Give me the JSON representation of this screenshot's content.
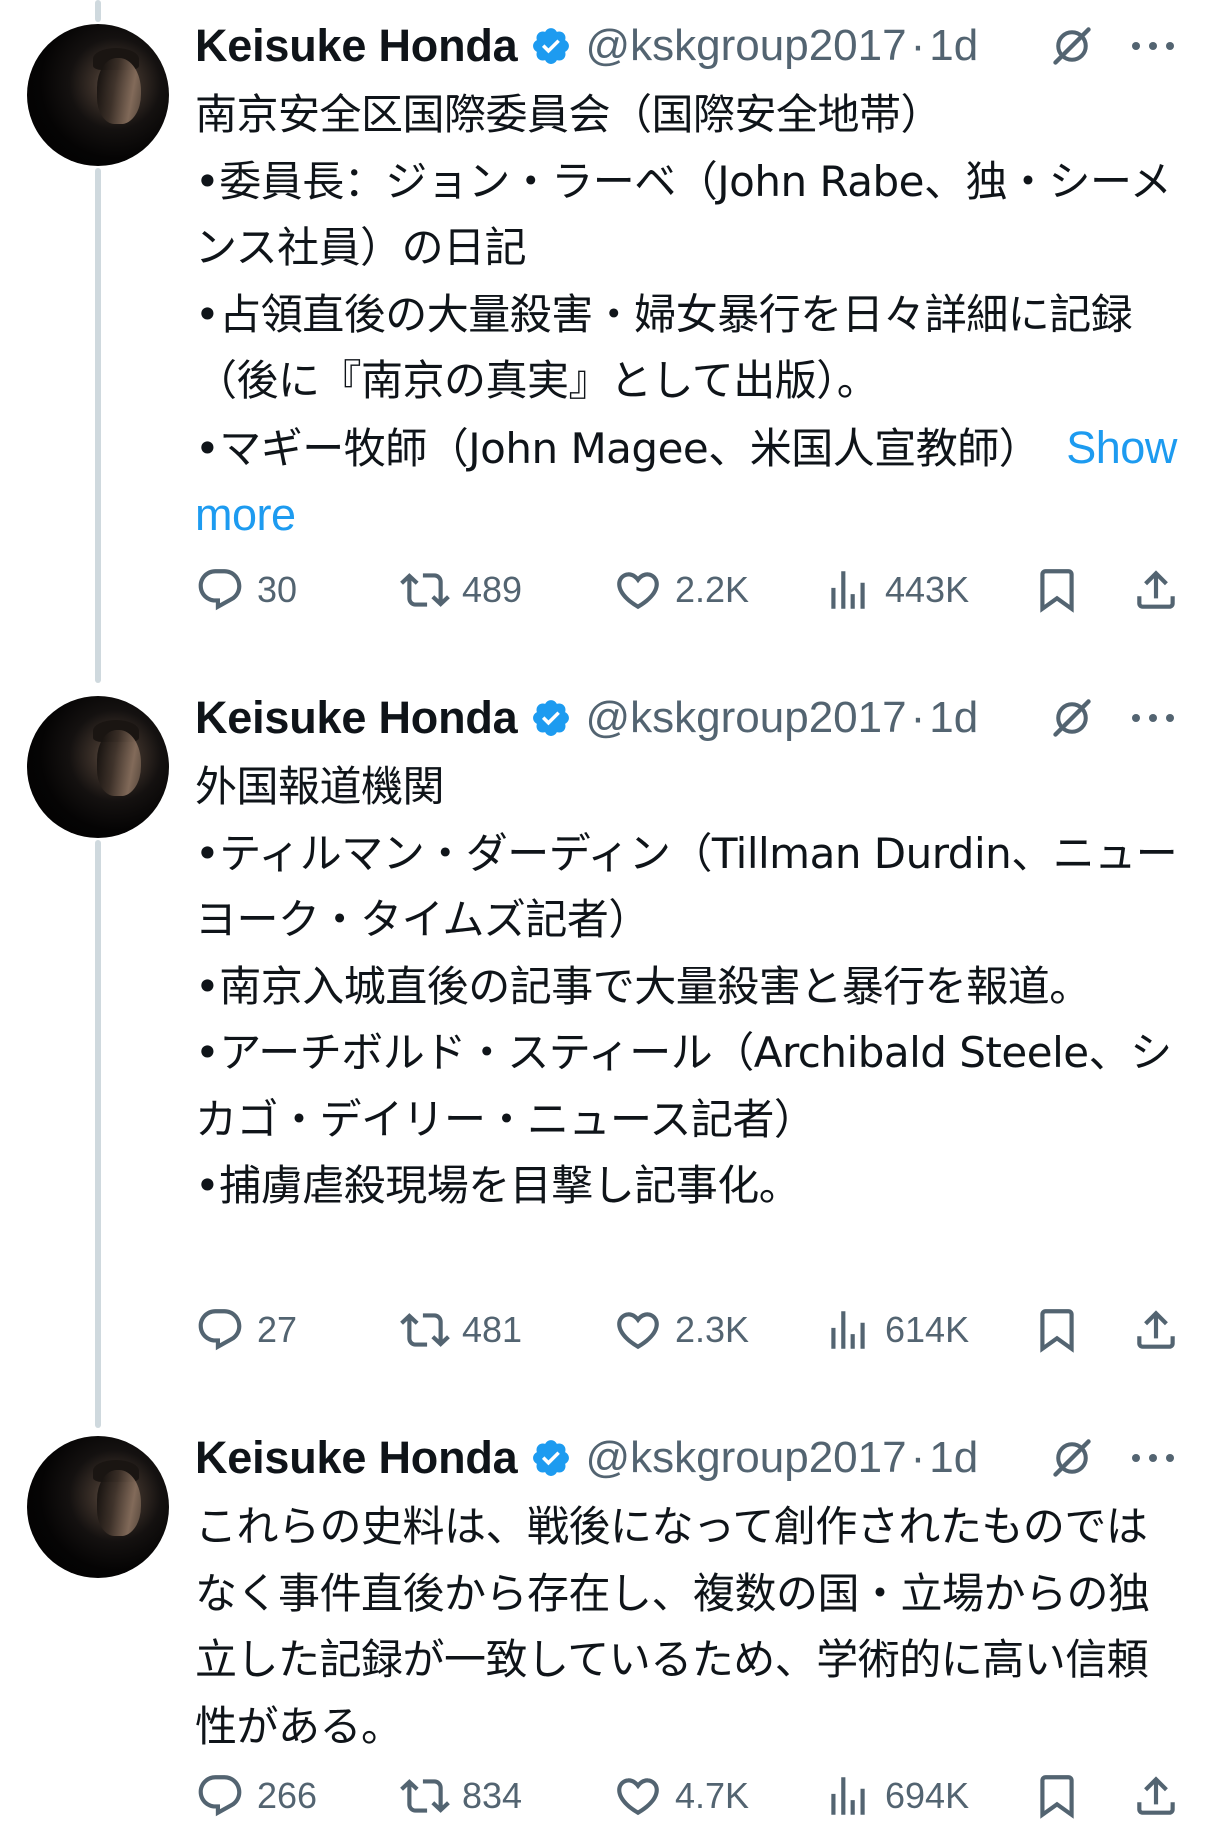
{
  "tweets": [
    {
      "name": "Keisuke Honda",
      "handle": "@kskgroup2017",
      "separator": "·",
      "time": "1d",
      "text": "南京安全区国際委員会（国際安全地帯）\n•委員長：ジョン・ラーベ（John Rabe、独・シーメンス社員）の日記\n•占領直後の大量殺害・婦女暴行を日々詳細に記録（後に『南京の真実』として出版）。\n•マギー牧師（John Magee、米国人宣教師）",
      "show_more": "Show more",
      "replies": "30",
      "retweets": "489",
      "likes": "2.2K",
      "views": "443K"
    },
    {
      "name": "Keisuke Honda",
      "handle": "@kskgroup2017",
      "separator": "·",
      "time": "1d",
      "text": "外国報道機関\n•ティルマン・ダーディン（Tillman Durdin、ニューヨーク・タイムズ記者）\n•南京入城直後の記事で大量殺害と暴行を報道。\n•アーチボルド・スティール（Archibald Steele、シカゴ・デイリー・ニュース記者）\n•捕虜虐殺現場を目撃し記事化。",
      "replies": "27",
      "retweets": "481",
      "likes": "2.3K",
      "views": "614K"
    },
    {
      "name": "Keisuke Honda",
      "handle": "@kskgroup2017",
      "separator": "·",
      "time": "1d",
      "text": "これらの史料は、戦後になって創作されたものではなく事件直後から存在し、複数の国・立場からの独立した記録が一致しているため、学術的に高い信頼性がある。",
      "replies": "266",
      "retweets": "834",
      "likes": "4.7K",
      "views": "694K"
    }
  ],
  "colors": {
    "text": "#0f1419",
    "secondary": "#536471",
    "accent": "#1d9bf0",
    "thread_line": "#cfd9de"
  },
  "icons": [
    "verified-badge-icon",
    "grok-icon",
    "more-icon",
    "reply-icon",
    "retweet-icon",
    "like-icon",
    "views-icon",
    "bookmark-icon",
    "share-icon"
  ]
}
